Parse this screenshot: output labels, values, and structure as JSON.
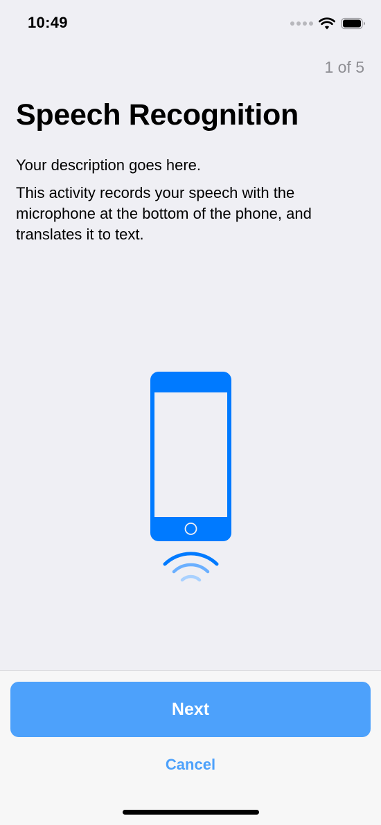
{
  "status_bar": {
    "time": "10:49",
    "icons": [
      "signal-dots-icon",
      "wifi-icon",
      "battery-icon"
    ]
  },
  "header": {
    "step_counter": "1 of 5",
    "title": "Speech Recognition"
  },
  "content": {
    "description": "Your description goes here.",
    "detail": "This activity records your speech with the microphone at the bottom of the phone, and translates it to text."
  },
  "illustration": {
    "icon": "phone-speech-icon",
    "accent_color": "#007aff",
    "wave_light_color": "#8dc2ff"
  },
  "footer": {
    "next_label": "Next",
    "cancel_label": "Cancel",
    "button_color": "#4da1fb"
  }
}
